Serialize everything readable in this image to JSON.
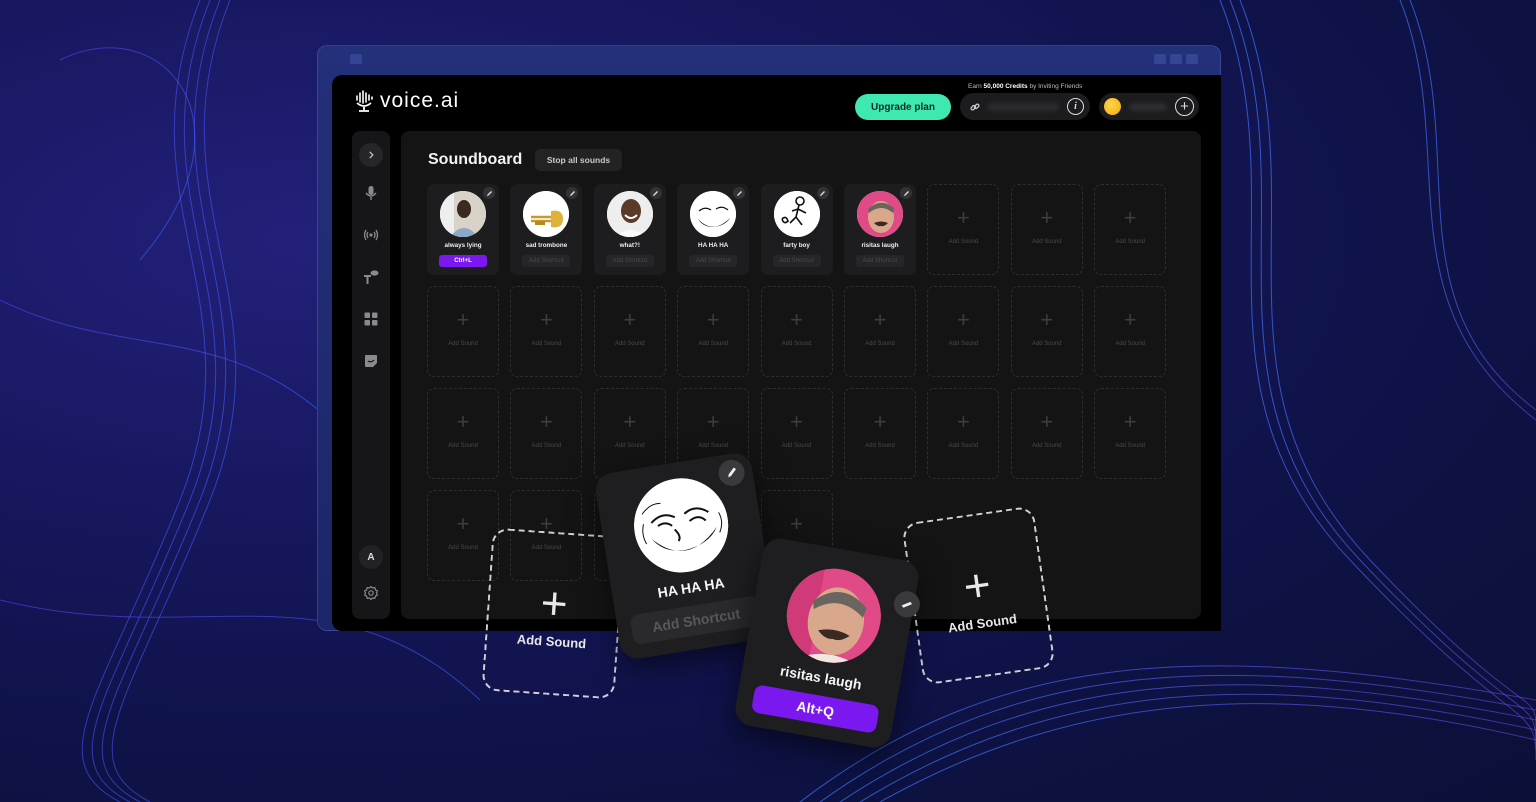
{
  "app": {
    "brand": "voice.ai",
    "upgrade_label": "Upgrade plan",
    "earn_prefix": "Earn",
    "earn_amount": "50,000 Credits",
    "earn_suffix": "by Inviting Friends",
    "avatar_initial": "A"
  },
  "icons": {
    "expand": "chevron-right-icon",
    "mic": "microphone-icon",
    "broadcast": "broadcast-icon",
    "tts": "text-to-speech-icon",
    "grid": "grid-icon",
    "sticker": "sticker-icon",
    "settings": "gear-icon",
    "link": "link-icon",
    "info": "info-icon",
    "coin": "coin-icon",
    "add": "plus-icon",
    "edit": "pencil-icon"
  },
  "colors": {
    "accent_green": "#3ee8b0",
    "shortcut_purple": "#7b18f0",
    "panel": "#141415",
    "background": "#15165a"
  },
  "soundboard": {
    "title": "Soundboard",
    "stop_label": "Stop all sounds",
    "add_sound_label": "Add Sound",
    "add_shortcut_label": "Add Shortcut",
    "sounds": [
      {
        "name": "always lying",
        "shortcut": "Ctrl+L",
        "avatar": "man-portrait"
      },
      {
        "name": "sad trombone",
        "shortcut": "",
        "avatar": "trombone"
      },
      {
        "name": "what?!",
        "shortcut": "",
        "avatar": "smiling-man"
      },
      {
        "name": "HA HA HA",
        "shortcut": "",
        "avatar": "trollface"
      },
      {
        "name": "farty boy",
        "shortcut": "",
        "avatar": "stick-figure"
      },
      {
        "name": "risitas laugh",
        "shortcut": "",
        "avatar": "risitas"
      }
    ],
    "empty_slots": 26
  },
  "floating": {
    "add_left": {
      "label": "Add Sound"
    },
    "troll_card": {
      "name": "HA HA HA",
      "shortcut": "Add Shortcut"
    },
    "risitas_card": {
      "name": "risitas laugh",
      "shortcut": "Alt+Q"
    },
    "add_right": {
      "label": "Add Sound"
    }
  }
}
